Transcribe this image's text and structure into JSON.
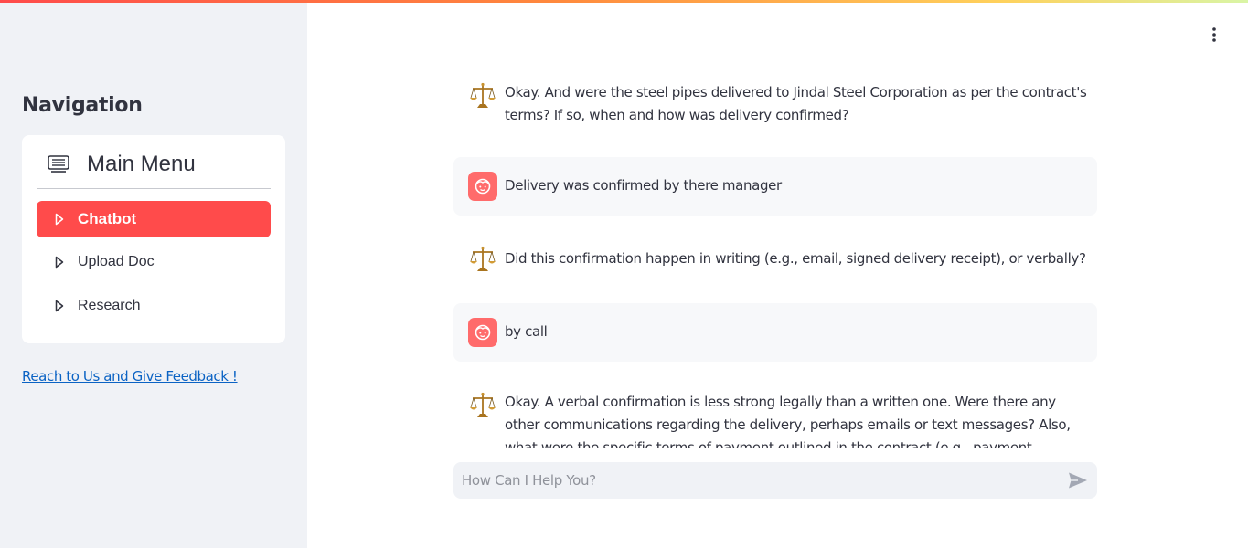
{
  "sidebar": {
    "title": "Navigation",
    "menu": {
      "header_icon": "list-icon",
      "title": "Main Menu",
      "items": [
        {
          "label": "Chatbot",
          "icon": "play-caret-icon",
          "active": true
        },
        {
          "label": "Upload Doc",
          "icon": "play-caret-icon",
          "active": false
        },
        {
          "label": "Research",
          "icon": "play-caret-icon",
          "active": false
        }
      ]
    },
    "feedback_link": "Reach to Us and Give Feedback !"
  },
  "header": {
    "menu_icon": "kebab-menu-icon"
  },
  "chat": {
    "messages": [
      {
        "role": "assistant",
        "avatar": "scales-of-justice-icon",
        "text": "Okay. And were the steel pipes delivered to Jindal Steel Corporation as per the contract's terms? If so, when and how was delivery confirmed?"
      },
      {
        "role": "user",
        "avatar": "user-face-icon",
        "text": "Delivery was confirmed by there manager"
      },
      {
        "role": "assistant",
        "avatar": "scales-of-justice-icon",
        "text": "Did this confirmation happen in writing (e.g., email, signed delivery receipt), or verbally?"
      },
      {
        "role": "user",
        "avatar": "user-face-icon",
        "text": "by call"
      },
      {
        "role": "assistant",
        "avatar": "scales-of-justice-icon",
        "text": "Okay. A verbal confirmation is less strong legally than a written one. Were there any other communications regarding the delivery, perhaps emails or text messages? Also, what were the specific terms of payment outlined in the contract (e.g., payment schedule, method of payment)?"
      }
    ]
  },
  "input": {
    "placeholder": "How Can I Help You?",
    "value": "",
    "send_icon": "send-icon"
  },
  "colors": {
    "accent": "#ff4b4b",
    "sidebar_bg": "#f0f2f6",
    "link": "#0b63c4",
    "user_avatar": "#ff6b6b"
  }
}
